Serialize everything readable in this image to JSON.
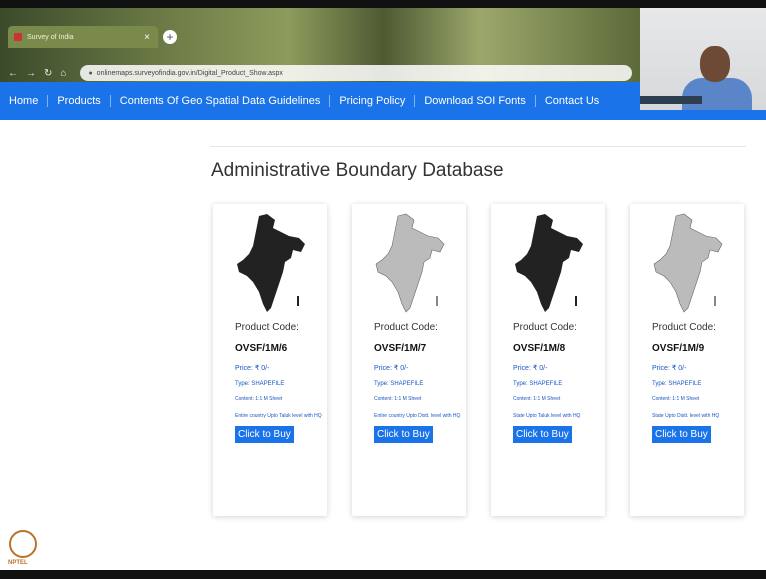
{
  "browser": {
    "tab_title": "Survey of India",
    "new_tab_icon": "+",
    "url": "onlinemaps.surveyofindia.gov.in/Digital_Product_Show.aspx"
  },
  "nav": {
    "items": [
      "Home",
      "Products",
      "Contents Of Geo Spatial Data Guidelines",
      "Pricing Policy",
      "Download SOI Fonts",
      "Contact Us"
    ]
  },
  "page": {
    "title": "Administrative Boundary Database"
  },
  "products": [
    {
      "code_label": "Product Code:",
      "code": "OVSF/1M/6",
      "price": "Price: ₹ 0/-",
      "type": "Type: SHAPEFILE",
      "content": "Content: 1:1 M Sheet",
      "description": "Entire country Upto Taluk level with HQ",
      "buy_label": "Click to Buy",
      "map_shade": "dark"
    },
    {
      "code_label": "Product Code:",
      "code": "OVSF/1M/7",
      "price": "Price: ₹ 0/-",
      "type": "Type: SHAPEFILE",
      "content": "Content: 1:1 M Sheet",
      "description": "Entire country Upto Distt. level with HQ",
      "buy_label": "Click to Buy",
      "map_shade": "light"
    },
    {
      "code_label": "Product Code:",
      "code": "OVSF/1M/8",
      "price": "Price: ₹ 0/-",
      "type": "Type: SHAPEFILE",
      "content": "Content: 1:1 M Sheet",
      "description": "State Upto Taluk level with HQ",
      "buy_label": "Click to Buy",
      "map_shade": "dark"
    },
    {
      "code_label": "Product Code:",
      "code": "OVSF/1M/9",
      "price": "Price: ₹ 0/-",
      "type": "Type: SHAPEFILE",
      "content": "Content: 1:1 M Sheet",
      "description": "State Upto Distt. level with HQ",
      "buy_label": "Click to Buy",
      "map_shade": "light"
    }
  ],
  "branding": {
    "nptel": "NPTEL"
  },
  "colors": {
    "nav_bg": "#1a73e8",
    "link": "#1a56c4"
  }
}
